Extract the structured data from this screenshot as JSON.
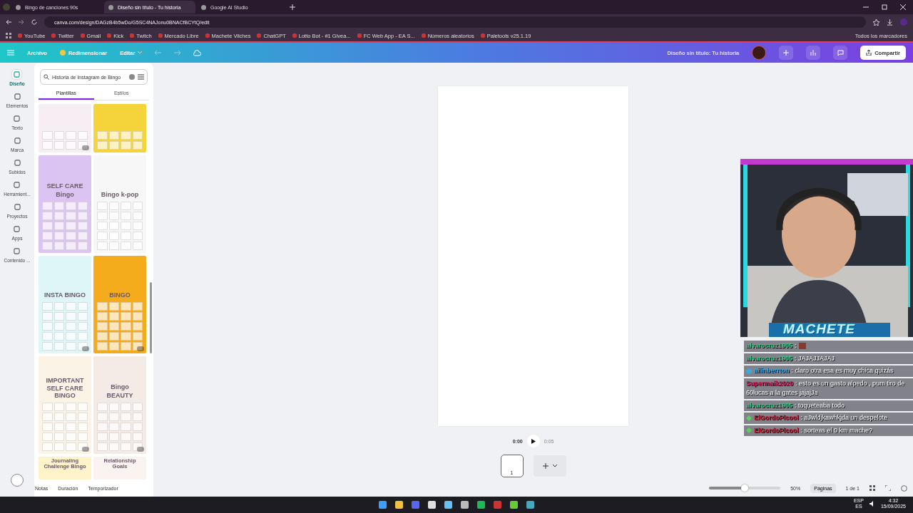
{
  "browser": {
    "tabs": [
      {
        "title": "Bingo de canciones 90s",
        "selected": false
      },
      {
        "title": "Diseño sin título - Tu historia",
        "selected": true
      },
      {
        "title": "Google AI Studio",
        "selected": false
      }
    ],
    "url": "canva.com/design/DAGzB4b5wDo/G5SC4NAJonu0BNACfBCYtQ/edit",
    "bookmarks": [
      "YouTube",
      "Twitter",
      "Gmail",
      "Kick",
      "Twitch",
      "Mercado Libre",
      "Machete Vilches",
      "ChatGPT",
      "Lotto Bot - #1 Givea...",
      "FC Web App - EA S...",
      "Números aleatorios",
      "Paletools v25.1.19"
    ],
    "all_bookmarks": "Todos los marcadores"
  },
  "header": {
    "menu": [
      "Archivo",
      "Redimensionar",
      "Editar"
    ],
    "title": "Diseño sin título: Tu historia",
    "share": "Compartir"
  },
  "rail": [
    {
      "label": "Diseño",
      "selected": true
    },
    {
      "label": "Elementos",
      "selected": false
    },
    {
      "label": "Texto",
      "selected": false
    },
    {
      "label": "Marca",
      "selected": false
    },
    {
      "label": "Subidos",
      "selected": false
    },
    {
      "label": "Herramient...",
      "selected": false
    },
    {
      "label": "Proyectos",
      "selected": false
    },
    {
      "label": "Apps",
      "selected": false
    },
    {
      "label": "Contenido ...",
      "selected": false
    }
  ],
  "panel": {
    "search": "Historia de Instagram de Bingo",
    "tabs": [
      {
        "label": "Plantillas",
        "selected": true
      },
      {
        "label": "Estilos",
        "selected": false
      }
    ],
    "templates": [
      {
        "color": "#f6eef3",
        "premium": true
      },
      {
        "color": "#f5d33a",
        "premium": false
      },
      {
        "headings": [
          "SELF CARE",
          "Bingo"
        ],
        "color": "#dcc4f2",
        "premium": false
      },
      {
        "headings": [
          "Bingo k-pop"
        ],
        "color": "#f7f7f7",
        "premium": false
      },
      {
        "headings": [
          "INSTA BINGO"
        ],
        "color": "#dff6f8",
        "premium": true
      },
      {
        "headings": [
          "BINGO"
        ],
        "color": "#f4ab1c",
        "premium": true
      },
      {
        "headings": [
          "IMPORTANT",
          "SELF CARE BINGO"
        ],
        "color": "#fbf3e6",
        "premium": true
      },
      {
        "headings": [
          "Bingo",
          "BEAUTY"
        ],
        "color": "#f5ebe6",
        "premium": true
      },
      {
        "headings": [
          "Journaling Challenge Bingo"
        ],
        "color": "#fff3c9",
        "premium": false
      },
      {
        "headings": [
          "Relationship Goals"
        ],
        "color": "#faf3ef",
        "premium": false
      }
    ]
  },
  "timeline": {
    "current": "0:00",
    "total": "0:05",
    "page": "1"
  },
  "footer": {
    "tools": [
      "Notas",
      "Duración",
      "Temporizador"
    ],
    "zoom": {
      "level": 0.5,
      "reading": "50%"
    },
    "pages": "Páginas",
    "page_count": "1 de 1"
  },
  "stream": {
    "overlay_name": "MACHETE",
    "chat": [
      {
        "user": "alvarocruz1905",
        "color": "#2fd08a",
        "kind": "emote",
        "text": ":"
      },
      {
        "user": "alvarocruz1905",
        "color": "#2fd08a",
        "kind": "plain",
        "text": ": JAJAJJAJAJ"
      },
      {
        "user": "ailinberrton",
        "color": "#3fa6e0",
        "kind": "cube",
        "text": ": claro otra esa es muy chica quizás"
      },
      {
        "user": "Supermaik2020",
        "color": "#c8245a",
        "kind": "plain",
        "text": ": esto es un gasto alpedo , pum tiro de 60lucas a la gates jajajJa"
      },
      {
        "user": "alvarocruz1905",
        "color": "#2fd08a",
        "kind": "plain",
        "text": ": toqueteaba todo"
      },
      {
        "user": "ElGordoPlcool",
        "color": "#c8203a",
        "kind": "gem",
        "text": ": aJwldjkawhkjda un despelote"
      },
      {
        "user": "ElGordoPlcool",
        "color": "#c8203a",
        "kind": "gem",
        "text": ": sorteas el 0 km mache?"
      }
    ]
  },
  "taskbar": {
    "lang": "ESP",
    "layout": "ES",
    "time": "4:32",
    "date": "15/09/2025"
  }
}
